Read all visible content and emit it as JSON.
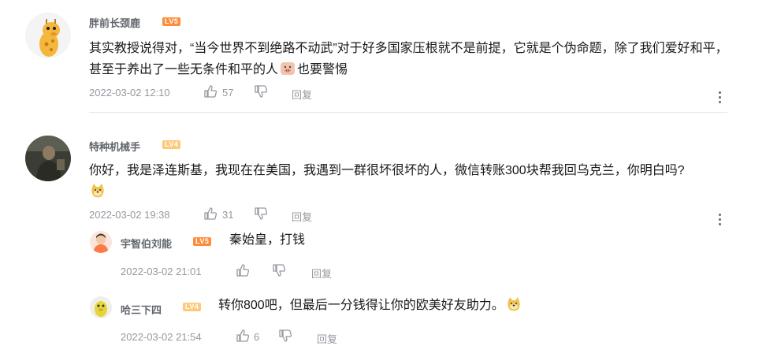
{
  "comments": [
    {
      "user": "胖前长颈鹿",
      "level": "LV5",
      "text": "其实教授说得对，“当今世界不到绝路不动武”对于好多国家压根就不是前提，它就是个伪命题，除了我们爱好和平，甚至于养出了一些无条件和平的人",
      "text_after_emoji": "也要警惕",
      "emoji": "pig-face-emoji",
      "time": "2022-03-02 12:10",
      "likes": "57",
      "reply_label": "回复"
    },
    {
      "user": "特种机械手",
      "level": "LV4",
      "text": "你好，我是泽连斯基，我现在在美国，我遇到一群很坏很坏的人，微信转账300块帮我回乌克兰，你明白吗?",
      "emoji": "doge-emoji",
      "time": "2022-03-02 19:38",
      "likes": "31",
      "reply_label": "回复",
      "replies": [
        {
          "user": "宇智伯刘能",
          "level": "LV5",
          "text": "秦始皇，打钱",
          "time": "2022-03-02 21:01",
          "likes": "",
          "reply_label": "回复"
        },
        {
          "user": "哈三下四",
          "level": "LV4",
          "text": "转你800吧，但最后一分钱得让你的欧美好友助力。",
          "emoji": "doge-emoji",
          "time": "2022-03-02 21:54",
          "likes": "6",
          "reply_label": "回复"
        }
      ]
    }
  ]
}
